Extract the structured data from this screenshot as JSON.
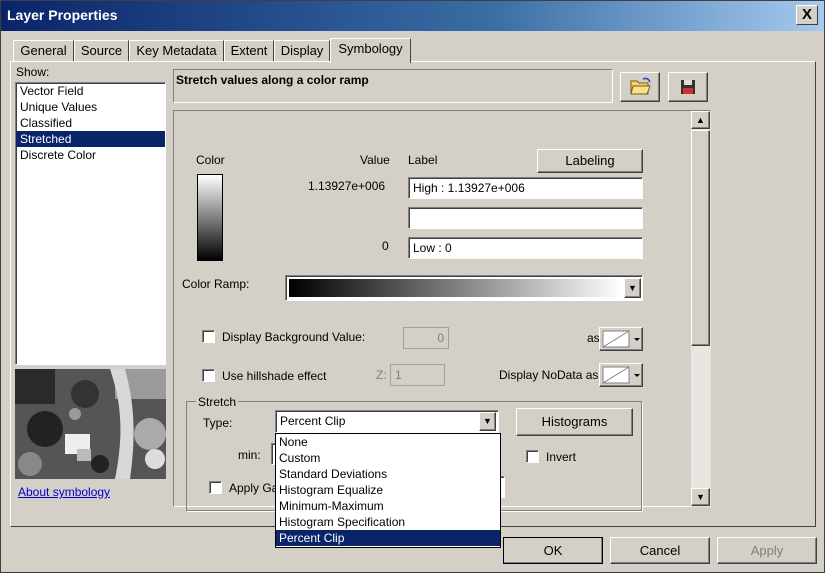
{
  "window": {
    "title": "Layer Properties",
    "close": "X"
  },
  "tabs": [
    "General",
    "Source",
    "Key Metadata",
    "Extent",
    "Display",
    "Symbology"
  ],
  "show": {
    "label": "Show:",
    "items": [
      "Vector Field",
      "Unique Values",
      "Classified",
      "Stretched",
      "Discrete Color"
    ],
    "selected": "Stretched"
  },
  "about_link": "About symbology",
  "description": "Stretch values along a color ramp",
  "columns": {
    "color": "Color",
    "value": "Value",
    "label": "Label"
  },
  "labeling_button": "Labeling",
  "high": {
    "value": "1.13927e+006",
    "label": "High : 1.13927e+006"
  },
  "middle": {
    "label": ""
  },
  "low": {
    "value": "0",
    "label": "Low : 0"
  },
  "color_ramp_label": "Color Ramp:",
  "background": {
    "label": "Display Background Value:",
    "value": "0",
    "as": "as"
  },
  "hillshade": {
    "label": "Use hillshade effect",
    "z_label": "Z:",
    "z_value": "1"
  },
  "nodata": {
    "label": "Display NoData as"
  },
  "stretch": {
    "legend": "Stretch",
    "type_label": "Type:",
    "type_value": "Percent Clip",
    "histograms_button": "Histograms",
    "min_label": "min:",
    "invert_label": "Invert",
    "apply_label": "Apply Ga"
  },
  "type_options": [
    "None",
    "Custom",
    "Standard Deviations",
    "Histogram Equalize",
    "Minimum-Maximum",
    "Histogram Specification",
    "Percent Clip"
  ],
  "footer": {
    "ok": "OK",
    "cancel": "Cancel",
    "apply": "Apply"
  },
  "colors": {
    "title_start": "#0a246a",
    "selection": "#0a246a",
    "face": "#d4d0c8"
  }
}
